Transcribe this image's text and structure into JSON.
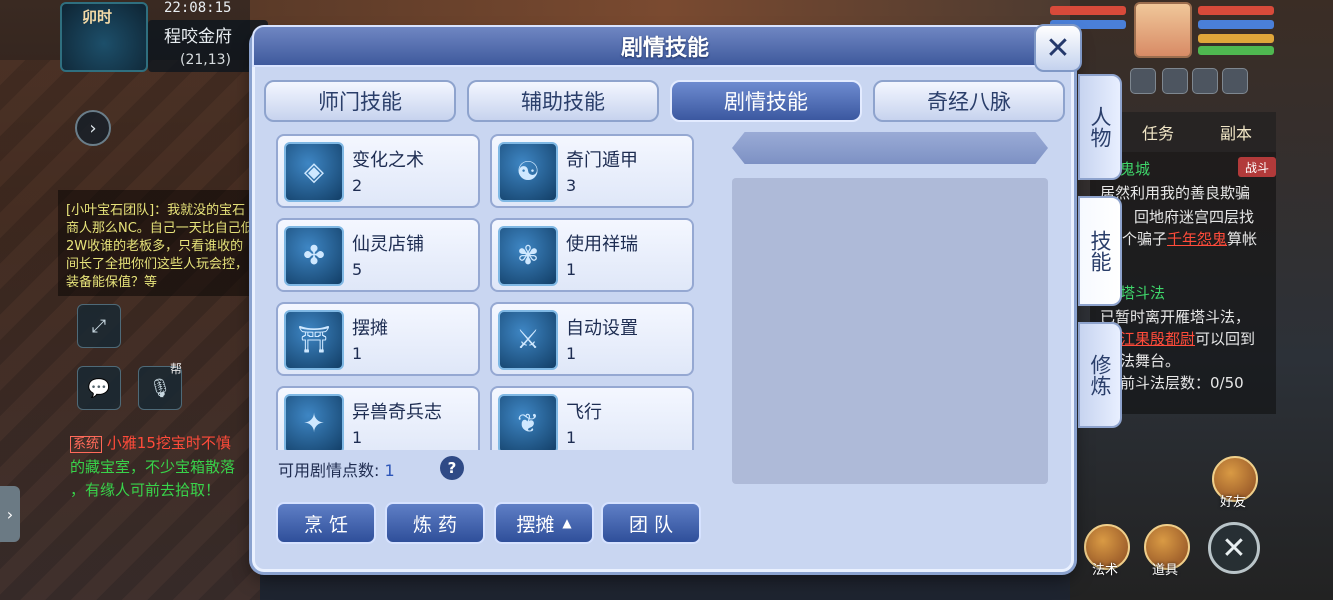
{
  "location": {
    "time_period": "卯时",
    "clock": "22:08:15",
    "map_name": "程咬金府",
    "coords": "(21,13)"
  },
  "chat": {
    "message": "[小叶宝石团队]：我就没的宝石商人那么NC。自己一天比自己低2W收谁的老板多，只看谁收的间长了全把你们这些人玩会控，装备能保值？等"
  },
  "system_message": {
    "tag": "系统",
    "speaker": "小雅15",
    "text_part1": "挖宝时不慎",
    "text_part2": "的藏宝室，不少宝箱散落",
    "text_part3": "，有缘人可前去拾取！"
  },
  "left_buttons": {
    "voice_badge": "帮"
  },
  "dialog": {
    "title": "剧情技能",
    "tabs": [
      {
        "label": "师门技能"
      },
      {
        "label": "辅助技能"
      },
      {
        "label": "剧情技能"
      },
      {
        "label": "奇经八脉"
      }
    ],
    "skills": [
      {
        "name": "变化之术",
        "level": "2",
        "icon": "transform-icon"
      },
      {
        "name": "奇门遁甲",
        "level": "3",
        "icon": "bagua-icon"
      },
      {
        "name": "仙灵店铺",
        "level": "5",
        "icon": "shop-icon"
      },
      {
        "name": "使用祥瑞",
        "level": "1",
        "icon": "auspicious-beast-icon"
      },
      {
        "name": "摆摊",
        "level": "1",
        "icon": "stall-icon"
      },
      {
        "name": "自动设置",
        "level": "1",
        "icon": "crossed-swords-icon"
      },
      {
        "name": "异兽奇兵志",
        "level": "1",
        "icon": "beast-weapon-icon"
      },
      {
        "name": "飞行",
        "level": "1",
        "icon": "wings-icon"
      }
    ],
    "points_label": "可用剧情点数:",
    "points_value": "1",
    "help_label": "?",
    "bottom_buttons": [
      {
        "label": "烹 饪"
      },
      {
        "label": "炼 药"
      },
      {
        "label": "摆摊"
      },
      {
        "label": "团 队"
      }
    ],
    "side_tabs": [
      {
        "label": "人物"
      },
      {
        "label": "技能"
      },
      {
        "label": "修炼"
      }
    ]
  },
  "hud": {
    "task_tabs": [
      {
        "label": "任务"
      },
      {
        "label": "副本"
      }
    ],
    "task_panel": {
      "quest1_title": "鬼城",
      "quest1_badge": "战斗",
      "quest1_line1": "居然利用我的善良欺骗",
      "quest1_line2": "回地府迷宫四层找",
      "quest1_line3a": "个骗子",
      "quest1_line3b": "千年怨鬼",
      "quest1_line3c": "算帐",
      "quest2_title": "塔斗法",
      "quest2_line1": "已暂时离开雁塔斗法，",
      "quest2_line2a": "江果殷都尉",
      "quest2_line2b": "可以回到",
      "quest2_line3": "法舞台。",
      "quest2_line4": "前斗法层数：0/50"
    },
    "action_icons": [
      {
        "label": "好友"
      },
      {
        "label": "法术"
      },
      {
        "label": "道具"
      }
    ]
  }
}
